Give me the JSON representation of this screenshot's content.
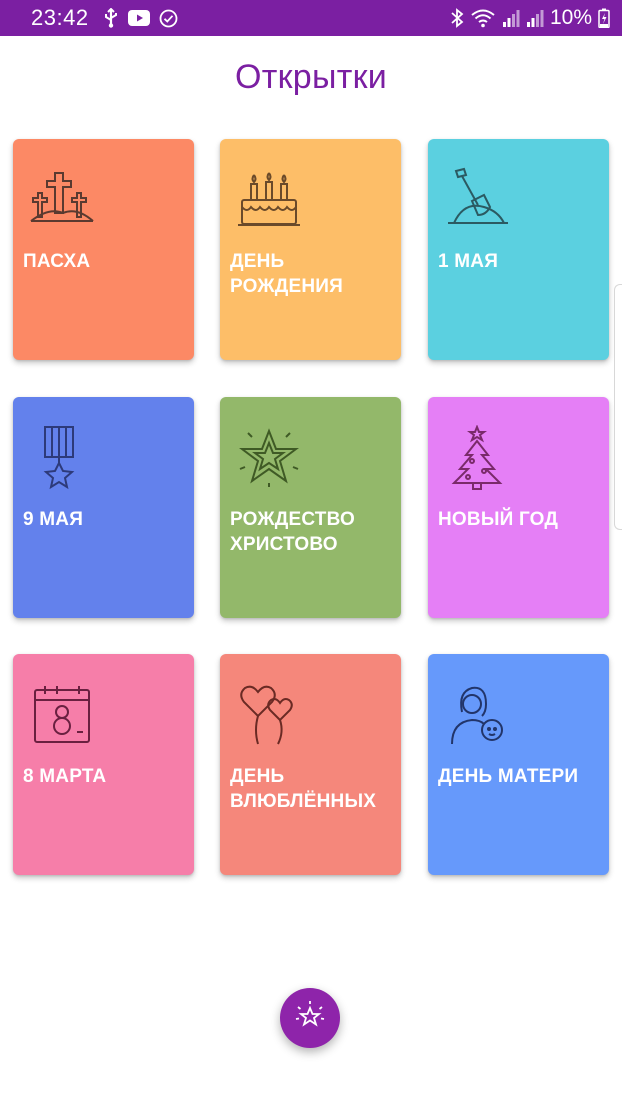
{
  "status_bar": {
    "time": "23:42",
    "battery": "10%",
    "background": "#7b1fa2",
    "left_icons": [
      "usb-icon",
      "youtube-icon",
      "check-circle-icon"
    ],
    "right_icons": [
      "bluetooth-icon",
      "wifi-icon",
      "signal-icon",
      "signal-icon",
      "battery-charging-icon"
    ]
  },
  "header": {
    "title": "Открытки",
    "color": "#7b1fa2"
  },
  "cards": [
    {
      "label": "ПАСХА",
      "icon": "crosses-icon",
      "color": "#fc8965"
    },
    {
      "label": "ДЕНЬ РОЖДЕНИЯ",
      "icon": "birthday-cake-icon",
      "color": "#fdbe68"
    },
    {
      "label": "1 МАЯ",
      "icon": "shovel-icon",
      "color": "#5bd0e0"
    },
    {
      "label": "9 МАЯ",
      "icon": "medal-icon",
      "color": "#6381ec"
    },
    {
      "label": "РОЖДЕСТВО ХРИСТОВО",
      "icon": "christmas-star-icon",
      "color": "#93b86a"
    },
    {
      "label": "НОВЫЙ ГОД",
      "icon": "christmas-tree-icon",
      "color": "#e57ff6"
    },
    {
      "label": "8 МАРТА",
      "icon": "calendar-8-icon",
      "color": "#f67ea9"
    },
    {
      "label": "ДЕНЬ ВЛЮБЛЁННЫХ",
      "icon": "heart-balloons-icon",
      "color": "#f5877b"
    },
    {
      "label": "ДЕНЬ МАТЕРИ",
      "icon": "mother-child-icon",
      "color": "#6699fb"
    }
  ],
  "fab": {
    "icon": "sparkle-star-icon",
    "color": "#8e24aa"
  }
}
